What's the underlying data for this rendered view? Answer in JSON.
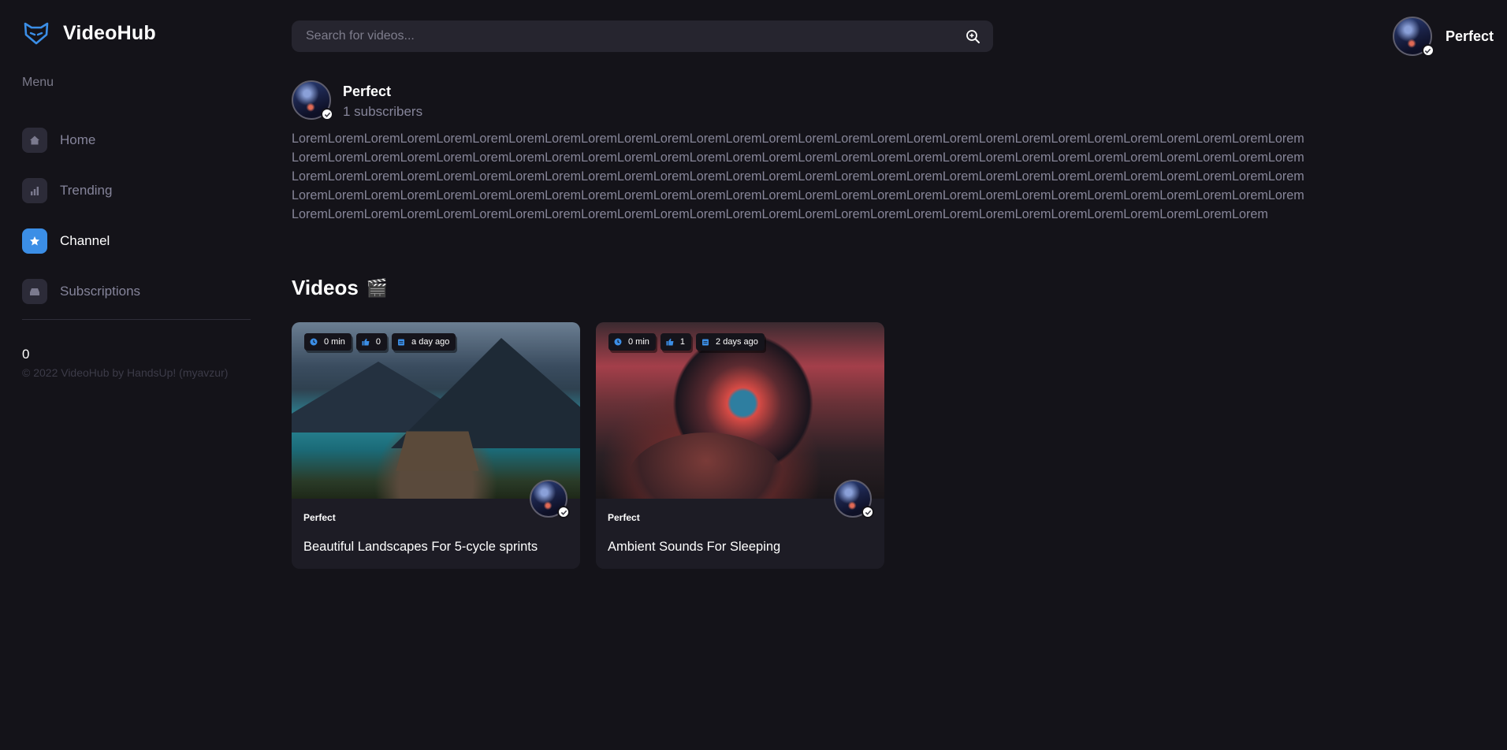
{
  "brand": {
    "name": "VideoHub",
    "accent": "#3b8ee6"
  },
  "sidebar": {
    "menu_label": "Menu",
    "items": [
      {
        "label": "Home",
        "icon": "home-icon",
        "active": false
      },
      {
        "label": "Trending",
        "icon": "bar-chart-icon",
        "active": false
      },
      {
        "label": "Channel",
        "icon": "star-icon",
        "active": true
      },
      {
        "label": "Subscriptions",
        "icon": "inbox-icon",
        "active": false
      }
    ],
    "counter": "0",
    "copyright": "© 2022 VideoHub by HandsUp! (myavzur)"
  },
  "header": {
    "search_placeholder": "Search for videos...",
    "user_name": "Perfect"
  },
  "channel": {
    "name": "Perfect",
    "subscribers": "1 subscribers",
    "description": "LoremLoremLoremLoremLoremLoremLoremLoremLoremLoremLoremLoremLoremLoremLoremLoremLoremLoremLoremLoremLoremLoremLoremLoremLoremLoremLoremLoremLoremLoremLoremLoremLoremLoremLoremLoremLoremLoremLoremLoremLoremLoremLoremLoremLoremLoremLoremLoremLoremLoremLoremLoremLoremLoremLoremLoremLoremLoremLoremLoremLoremLoremLoremLoremLoremLoremLoremLoremLoremLoremLoremLoremLoremLoremLoremLoremLoremLoremLoremLoremLoremLoremLoremLoremLoremLoremLoremLoremLoremLoremLoremLoremLoremLoremLoremLoremLoremLoremLoremLoremLoremLoremLoremLoremLoremLoremLoremLoremLoremLoremLoremLoremLoremLoremLoremLoremLoremLoremLoremLoremLoremLoremLoremLoremLoremLoremLoremLoremLoremLoremLoremLoremLoremLoremLoremLoremLoremLoremLorem"
  },
  "videos_section": {
    "title": "Videos",
    "emoji": "🎬"
  },
  "videos": [
    {
      "duration": "0 min",
      "likes": "0",
      "age": "a day ago",
      "author": "Perfect",
      "title": "Beautiful Landscapes For 5-cycle sprints"
    },
    {
      "duration": "0 min",
      "likes": "1",
      "age": "2 days ago",
      "author": "Perfect",
      "title": "Ambient Sounds For Sleeping"
    }
  ]
}
